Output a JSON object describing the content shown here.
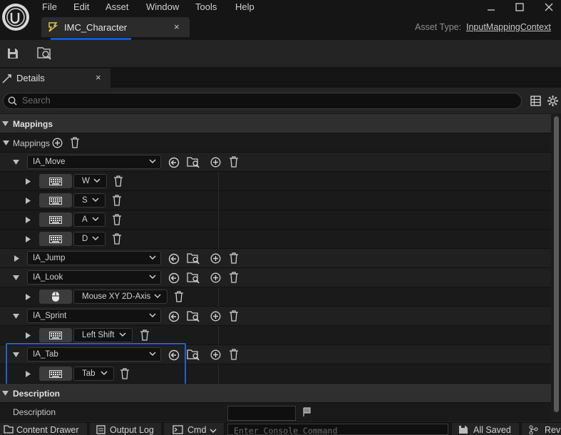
{
  "menu": [
    "File",
    "Edit",
    "Asset",
    "Window",
    "Tools",
    "Help"
  ],
  "document_tab": {
    "label": "IMC_Character",
    "close": "×"
  },
  "asset_type": {
    "label": "Asset Type:",
    "value": "InputMappingContext"
  },
  "details_tab": {
    "label": "Details",
    "close": "×"
  },
  "search": {
    "placeholder": "Search"
  },
  "mappings_category": "Mappings",
  "mappings_label": "Mappings",
  "actions": {
    "move": {
      "name": "IA_Move",
      "keys": [
        "W",
        "S",
        "A",
        "D"
      ]
    },
    "jump": {
      "name": "IA_Jump"
    },
    "look": {
      "name": "IA_Look",
      "keys": [
        "Mouse XY 2D-Axis"
      ]
    },
    "sprint": {
      "name": "IA_Sprint",
      "keys": [
        "Left Shift"
      ]
    },
    "tab": {
      "name": "IA_Tab",
      "keys": [
        "Tab"
      ]
    }
  },
  "description_category": "Description",
  "description_label": "Description",
  "statusbar": {
    "content_drawer": "Content Drawer",
    "output_log": "Output Log",
    "cmd": "Cmd",
    "console_placeholder": "Enter Console Command",
    "all_saved": "All Saved",
    "revision": "Rev"
  },
  "colors": {
    "accent_blue": "#1f5fd6",
    "background": "#1a1a1a",
    "category_row": "#2f2f2f"
  }
}
